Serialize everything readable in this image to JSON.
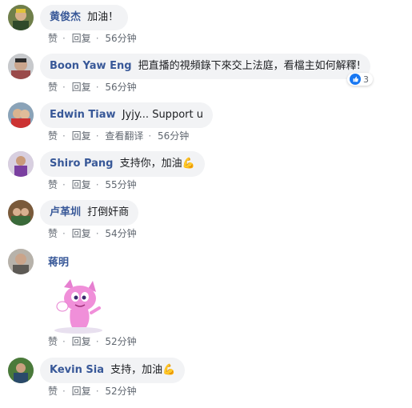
{
  "actions": {
    "like": "赞",
    "reply": "回复",
    "see_translation": "查看翻译"
  },
  "comments": [
    {
      "name": "黄俊杰",
      "text": "加油！",
      "time": "56分钟"
    },
    {
      "name": "Boon Yaw Eng",
      "text": "把直播的視頻錄下來交上法庭，看檔主如何解釋!",
      "time": "56分钟",
      "reactions": "3"
    },
    {
      "name": "Edwin Tiaw",
      "text": "Jyjy... Support u",
      "time": "56分钟"
    },
    {
      "name": "Shiro Pang",
      "text": "支持你，加油💪",
      "time": "55分钟"
    },
    {
      "name": "卢革圳",
      "text": "打倒奸商",
      "time": "54分钟"
    },
    {
      "name": "蒋明",
      "text": "",
      "time": "52分钟"
    },
    {
      "name": "Kevin Sia",
      "text": "支持，加油💪",
      "time": "52分钟"
    }
  ],
  "colors": {
    "name": "#385898",
    "bubble": "#f2f3f5",
    "meta": "#606770",
    "like": "#1877f2"
  }
}
